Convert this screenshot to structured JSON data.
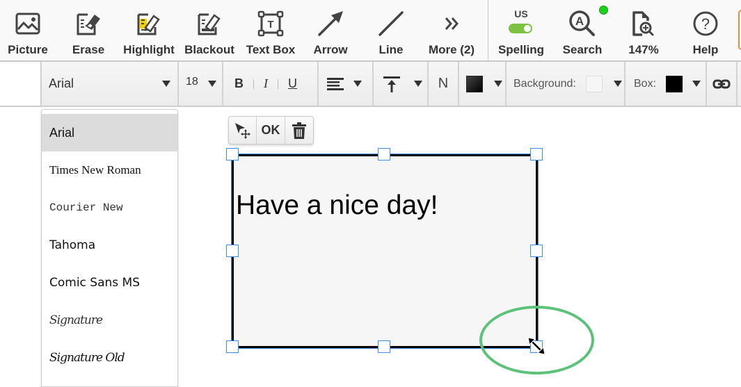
{
  "toolbar": {
    "tools": [
      {
        "id": "picture",
        "label": "Picture",
        "icon": "picture-icon"
      },
      {
        "id": "erase",
        "label": "Erase",
        "icon": "eraser-icon"
      },
      {
        "id": "highlight",
        "label": "Highlight",
        "icon": "highlighter-icon"
      },
      {
        "id": "blackout",
        "label": "Blackout",
        "icon": "blackout-icon"
      },
      {
        "id": "textbox",
        "label": "Text Box",
        "icon": "textbox-icon"
      },
      {
        "id": "arrow",
        "label": "Arrow",
        "icon": "arrow-icon"
      },
      {
        "id": "line",
        "label": "Line",
        "icon": "line-icon"
      },
      {
        "id": "more",
        "label": "More (2)",
        "icon": "double-chevron-icon"
      }
    ],
    "spelling": {
      "label": "Spelling",
      "locale": "US",
      "enabled": true
    },
    "search": {
      "label": "Search",
      "status_color": "#1ed01e"
    },
    "zoom": {
      "label": "147%"
    },
    "help": {
      "label": "Help"
    }
  },
  "format_bar": {
    "font": "Arial",
    "size": "18",
    "bold": "B",
    "italic": "I",
    "underline": "U",
    "normal": "N",
    "text_color": "#000000",
    "background_label": "Background:",
    "background_color": "#f6f6f6",
    "box_label": "Box:",
    "box_color": "#000000"
  },
  "font_dropdown": {
    "selected": "Arial",
    "options": [
      "Arial",
      "Times New Roman",
      "Courier New",
      "Tahoma",
      "Comic Sans MS",
      "Signature",
      "Signature Old"
    ]
  },
  "mini_toolbar": {
    "ok_label": "OK"
  },
  "text_box": {
    "content": "Have a nice day!"
  },
  "colors": {
    "accent": "#3a8ee6",
    "annotation": "#5cc27a",
    "toggle_on": "#7dc242"
  }
}
